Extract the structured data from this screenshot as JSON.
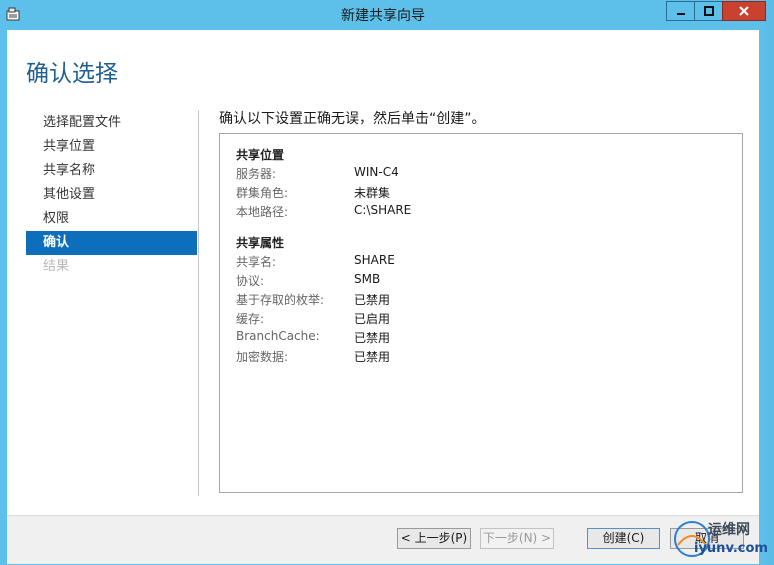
{
  "window": {
    "title": "新建共享向导"
  },
  "page": {
    "heading": "确认选择",
    "instruction": "确认以下设置正确无误，然后单击“创建”。"
  },
  "nav": {
    "items": [
      {
        "label": "选择配置文件",
        "state": "normal"
      },
      {
        "label": "共享位置",
        "state": "normal"
      },
      {
        "label": "共享名称",
        "state": "normal"
      },
      {
        "label": "其他设置",
        "state": "normal"
      },
      {
        "label": "权限",
        "state": "normal"
      },
      {
        "label": "确认",
        "state": "active"
      },
      {
        "label": "结果",
        "state": "disabled"
      }
    ]
  },
  "summary": {
    "location": {
      "title": "共享位置",
      "rows": [
        {
          "key": "服务器:",
          "value": "WIN-C4"
        },
        {
          "key": "群集角色:",
          "value": "未群集"
        },
        {
          "key": "本地路径:",
          "value": "C:\\SHARE"
        }
      ]
    },
    "properties": {
      "title": "共享属性",
      "rows": [
        {
          "key": "共享名:",
          "value": "SHARE"
        },
        {
          "key": "协议:",
          "value": "SMB"
        },
        {
          "key": "基于存取的枚举:",
          "value": "已禁用"
        },
        {
          "key": "缓存:",
          "value": "已启用"
        },
        {
          "key": "BranchCache:",
          "value": "已禁用"
        },
        {
          "key": "加密数据:",
          "value": "已禁用"
        }
      ]
    }
  },
  "footer": {
    "prev_label": "< 上一步(P)",
    "next_label": "下一步(N) >",
    "create_label": "创建(C)",
    "cancel_label": "取消"
  },
  "watermark": {
    "line1": "运维网",
    "line2": "iyunv.com"
  },
  "colors": {
    "accent": "#0d6ebb",
    "titlebar": "#5cc0ea",
    "close": "#c9412f"
  }
}
